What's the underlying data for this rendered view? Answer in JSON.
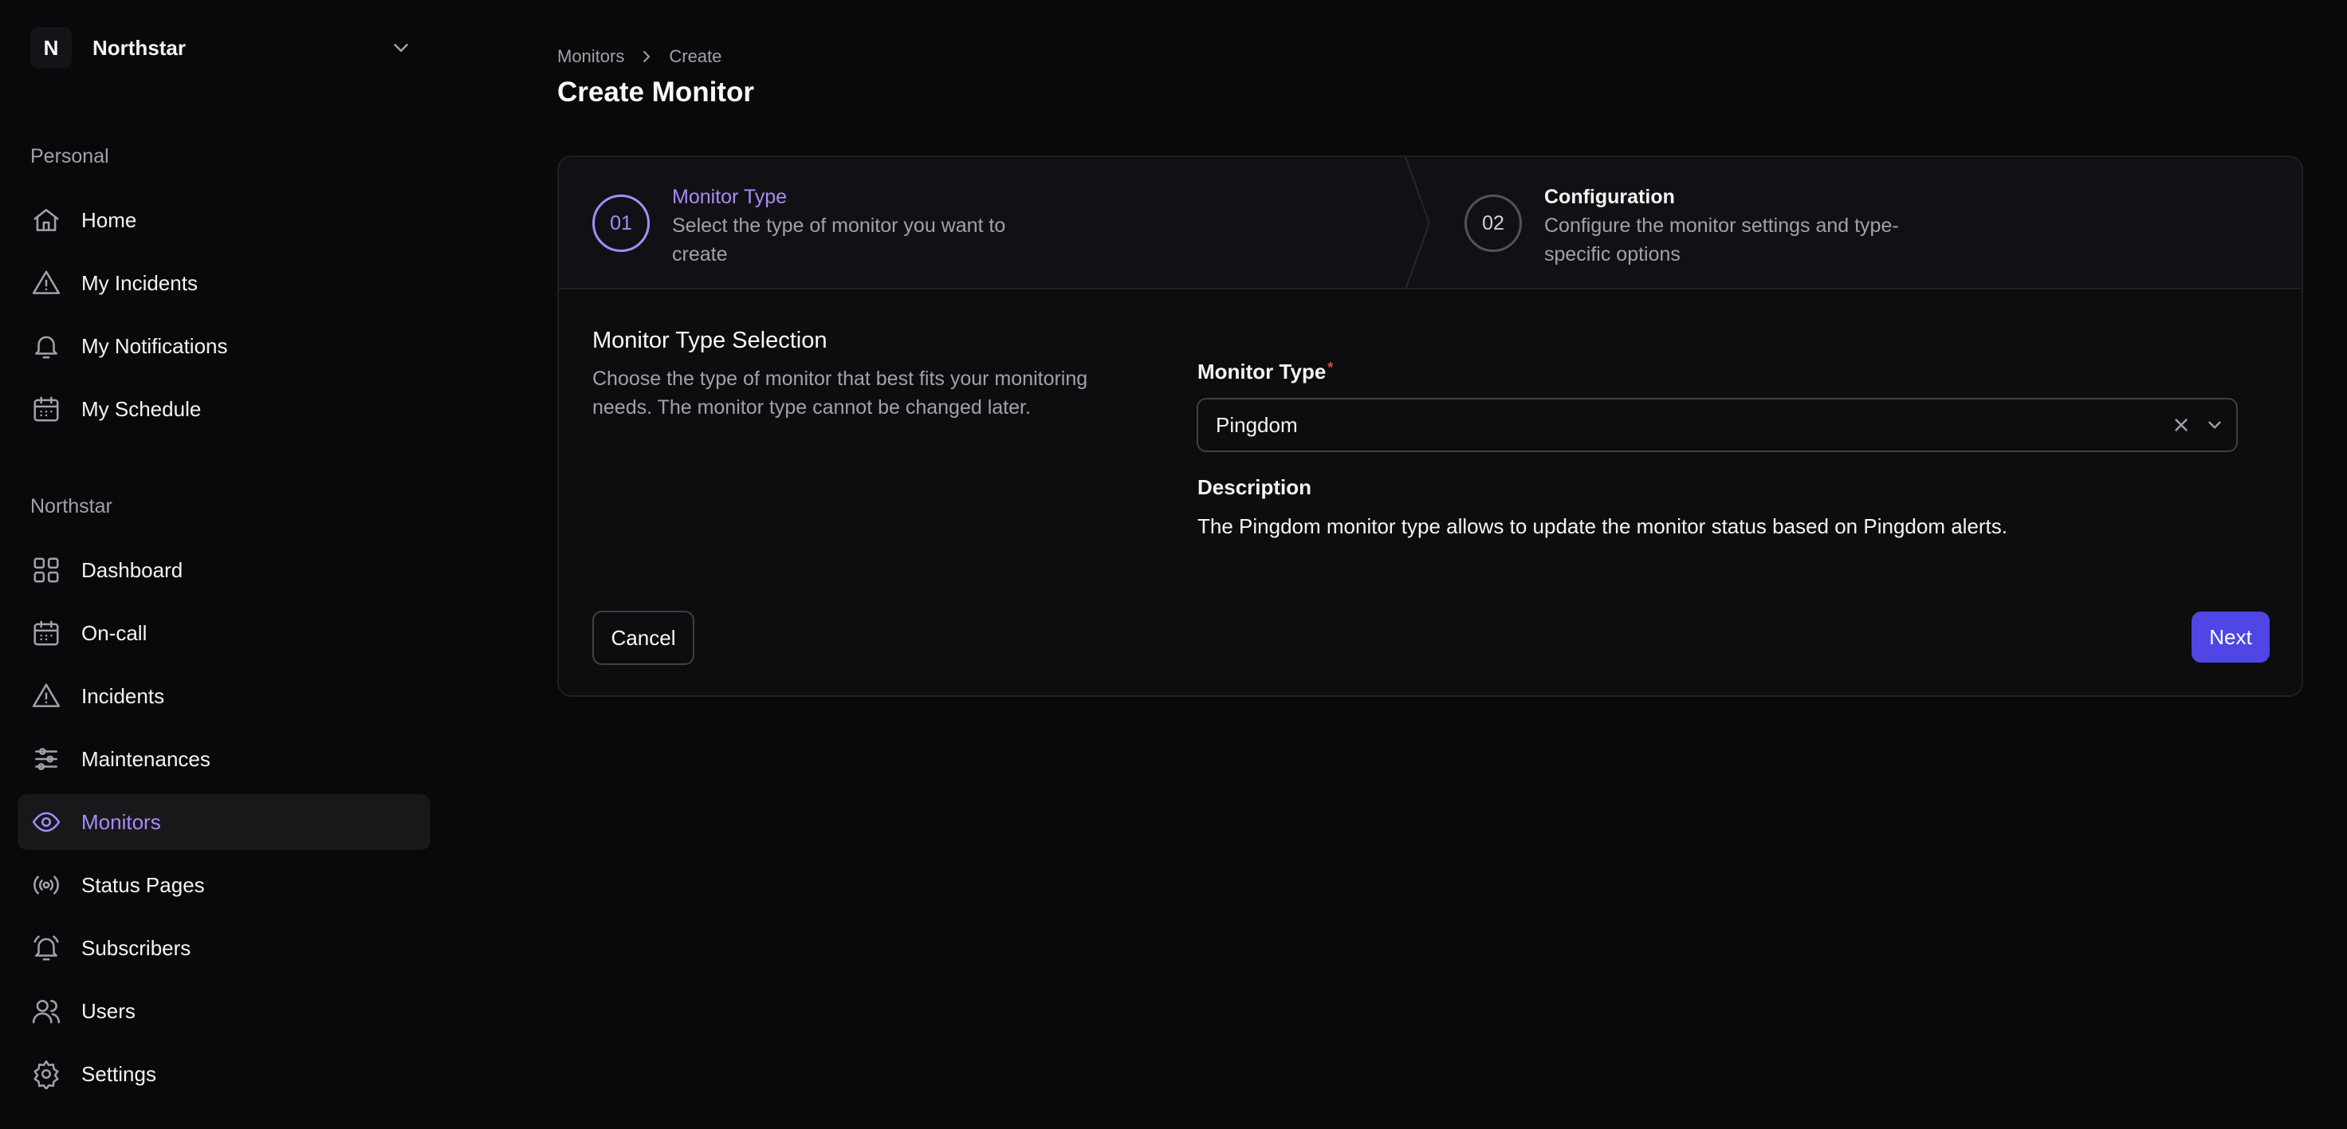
{
  "org": {
    "initial": "N",
    "name": "Northstar"
  },
  "sidebar": {
    "personal_label": "Personal",
    "personal_items": [
      {
        "label": "Home",
        "icon": "home-icon"
      },
      {
        "label": "My Incidents",
        "icon": "alert-triangle-icon"
      },
      {
        "label": "My Notifications",
        "icon": "bell-icon"
      },
      {
        "label": "My Schedule",
        "icon": "calendar-icon"
      }
    ],
    "org_label": "Northstar",
    "org_items": [
      {
        "label": "Dashboard",
        "icon": "grid-icon"
      },
      {
        "label": "On-call",
        "icon": "calendar-icon"
      },
      {
        "label": "Incidents",
        "icon": "alert-triangle-icon"
      },
      {
        "label": "Maintenances",
        "icon": "sliders-icon"
      },
      {
        "label": "Monitors",
        "icon": "eye-icon",
        "active": true
      },
      {
        "label": "Status Pages",
        "icon": "broadcast-icon"
      },
      {
        "label": "Subscribers",
        "icon": "bell-ring-icon"
      },
      {
        "label": "Users",
        "icon": "users-icon"
      },
      {
        "label": "Settings",
        "icon": "gear-icon"
      }
    ]
  },
  "breadcrumb": {
    "items": [
      "Monitors",
      "Create"
    ]
  },
  "page": {
    "title": "Create Monitor"
  },
  "stepper": {
    "steps": [
      {
        "number": "01",
        "title": "Monitor Type",
        "description": "Select the type of monitor you want to create"
      },
      {
        "number": "02",
        "title": "Configuration",
        "description": "Configure the monitor settings and type-specific options"
      }
    ]
  },
  "form": {
    "section_title": "Monitor Type Selection",
    "section_description": "Choose the type of monitor that best fits your monitoring needs. The monitor type cannot be changed later.",
    "field_label": "Monitor Type",
    "required_mark": "*",
    "selected_value": "Pingdom",
    "description_label": "Description",
    "description_text": "The Pingdom monitor type allows to update the monitor status based on Pingdom alerts."
  },
  "actions": {
    "cancel_label": "Cancel",
    "next_label": "Next"
  },
  "colors": {
    "accent": "#a78bfa",
    "primary_button": "#4f46e5",
    "background": "#09090b",
    "required": "#ef4444"
  }
}
